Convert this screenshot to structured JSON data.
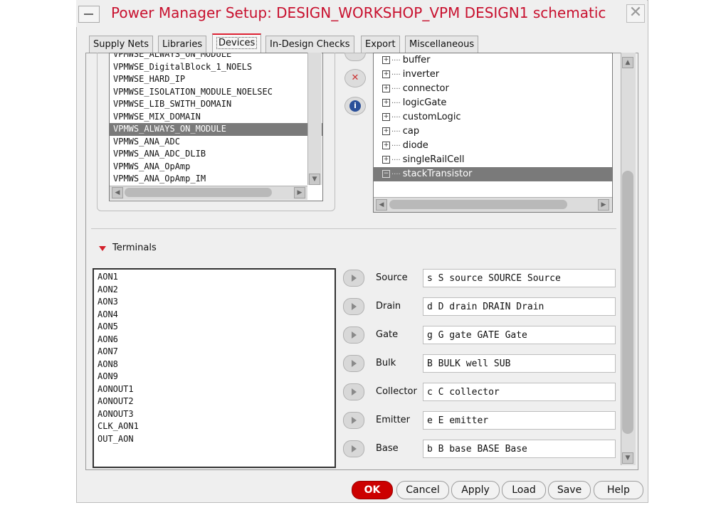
{
  "window": {
    "title": "Power Manager Setup: DESIGN_WORKSHOP_VPM DESIGN1 schematic",
    "close_glyph": "✕"
  },
  "tabs": [
    {
      "label": "Supply Nets"
    },
    {
      "label": "Libraries"
    },
    {
      "label": "Devices"
    },
    {
      "label": "In-Design Checks"
    },
    {
      "label": "Export"
    },
    {
      "label": "Miscellaneous"
    }
  ],
  "active_tab": "Devices",
  "cell_list": {
    "items": [
      "VPMWSE_ALWAYS_ON_MODULE",
      "VPMWSE_DigitalBlock_1_NOELS",
      "VPMWSE_HARD_IP",
      "VPMWSE_ISOLATION_MODULE_NOELSEC",
      "VPMWSE_LIB_SWITH_DOMAIN",
      "VPMWSE_MIX_DOMAIN",
      "VPMWS_ALWAYS_ON_MODULE",
      "VPMWS_ANA_ADC",
      "VPMWS_ANA_ADC_DLIB",
      "VPMWS_ANA_OpAmp",
      "VPMWS_ANA_OpAmp_IM"
    ],
    "selected": "VPMWS_ALWAYS_ON_MODULE"
  },
  "middle_buttons": {
    "delete_glyph": "✕",
    "info_glyph": "i"
  },
  "device_tree": {
    "items": [
      {
        "label": "buffer",
        "expander": "+"
      },
      {
        "label": "inverter",
        "expander": "+"
      },
      {
        "label": "connector",
        "expander": "+"
      },
      {
        "label": "logicGate",
        "expander": "+"
      },
      {
        "label": "customLogic",
        "expander": "+"
      },
      {
        "label": "cap",
        "expander": "+"
      },
      {
        "label": "diode",
        "expander": "+"
      },
      {
        "label": "singleRailCell",
        "expander": "+"
      },
      {
        "label": "stackTransistor",
        "expander": "−"
      }
    ],
    "selected": "stackTransistor"
  },
  "terminals": {
    "section_label": "Terminals",
    "list": [
      "AON1",
      "AON2",
      "AON3",
      "AON4",
      "AON5",
      "AON6",
      "AON7",
      "AON8",
      "AON9",
      "AONOUT1",
      "AONOUT2",
      "AONOUT3",
      "CLK_AON1",
      "OUT_AON"
    ],
    "fields": [
      {
        "label": "Source",
        "value": "s S source SOURCE Source"
      },
      {
        "label": "Drain",
        "value": "d D drain DRAIN Drain"
      },
      {
        "label": "Gate",
        "value": "g G gate GATE Gate"
      },
      {
        "label": "Bulk",
        "value": "B BULK well SUB"
      },
      {
        "label": "Collector",
        "value": "c C collector"
      },
      {
        "label": "Emitter",
        "value": "e E emitter"
      },
      {
        "label": "Base",
        "value": "b B base BASE Base"
      }
    ]
  },
  "buttons": {
    "ok": "OK",
    "cancel": "Cancel",
    "apply": "Apply",
    "load": "Load",
    "save": "Save",
    "help": "Help"
  },
  "colors": {
    "title": "#c8102e",
    "ok_button": "#cc0000",
    "selection": "#7a7a7a"
  }
}
